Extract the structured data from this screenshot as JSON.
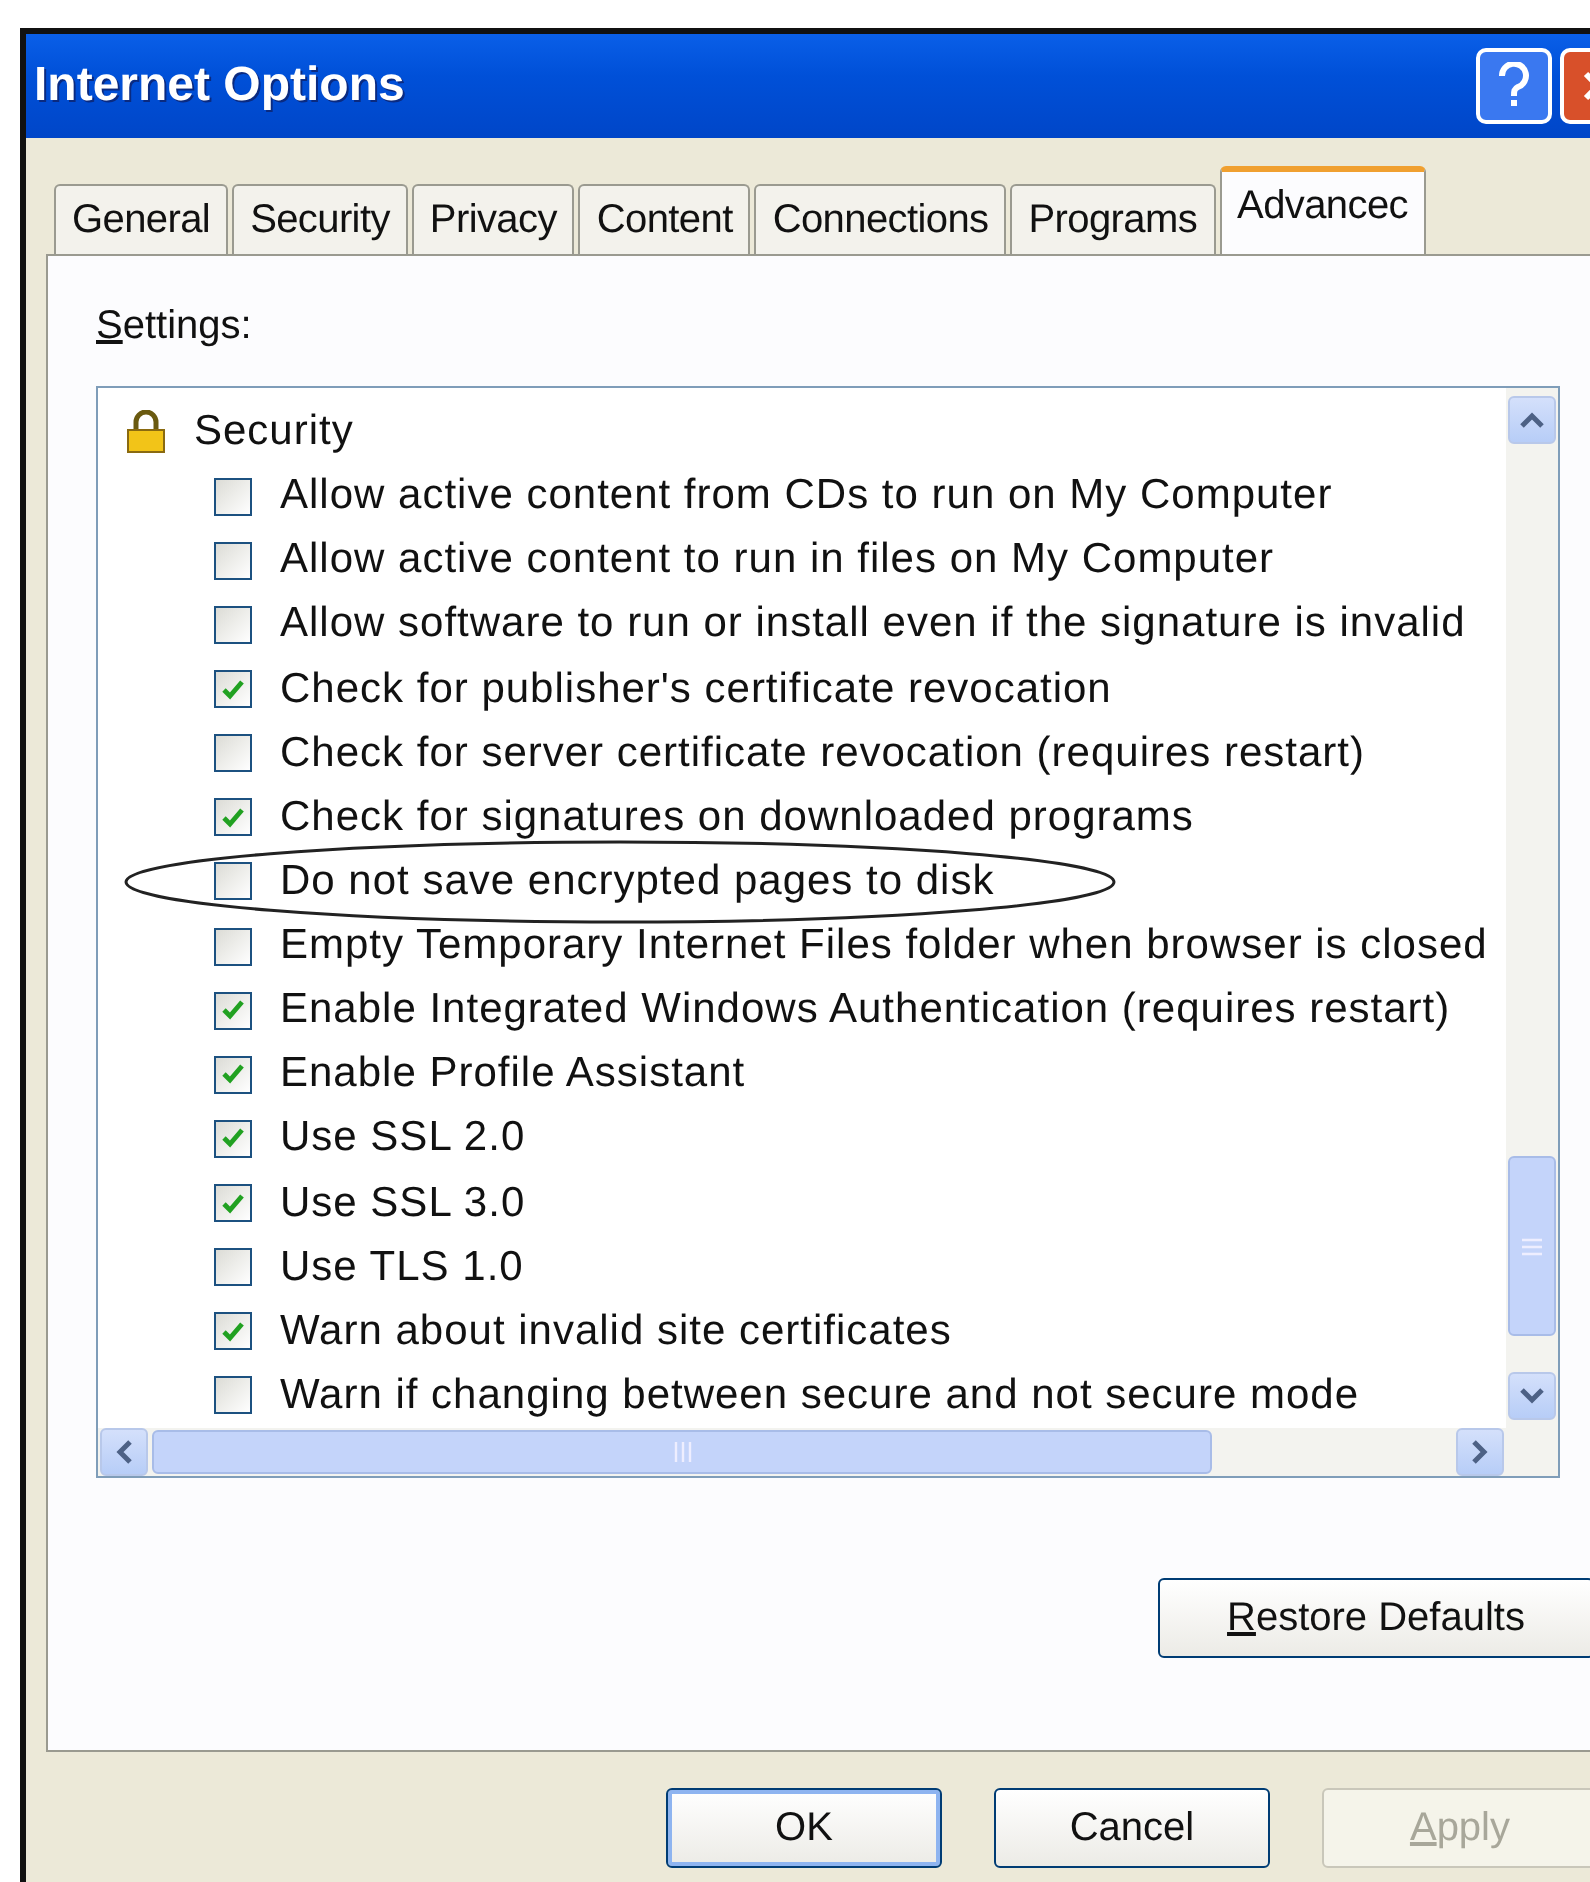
{
  "window": {
    "title": "Internet Options"
  },
  "tabs": [
    {
      "label": "General",
      "selected": false
    },
    {
      "label": "Security",
      "selected": false
    },
    {
      "label": "Privacy",
      "selected": false
    },
    {
      "label": "Content",
      "selected": false
    },
    {
      "label": "Connections",
      "selected": false
    },
    {
      "label": "Programs",
      "selected": false
    },
    {
      "label": "Advancec",
      "selected": true
    }
  ],
  "settings_label": {
    "text": "Settings:",
    "mnemonic": true
  },
  "settings": {
    "group": "Security",
    "items": [
      {
        "label": "Allow active content from CDs to run on My Computer",
        "checked": false,
        "circled": false
      },
      {
        "label": "Allow active content to run in files on My Computer",
        "checked": false,
        "circled": false
      },
      {
        "label": "Allow software to run or install even if the signature is invalid",
        "checked": false,
        "circled": false
      },
      {
        "label": "Check for publisher's certificate revocation",
        "checked": true,
        "circled": false
      },
      {
        "label": "Check for server certificate revocation (requires restart)",
        "checked": false,
        "circled": false
      },
      {
        "label": "Check for signatures on downloaded programs",
        "checked": true,
        "circled": false
      },
      {
        "label": "Do not save encrypted pages to disk",
        "checked": false,
        "circled": true
      },
      {
        "label": "Empty Temporary Internet Files folder when browser is closed",
        "checked": false,
        "circled": false
      },
      {
        "label": "Enable Integrated Windows Authentication (requires restart)",
        "checked": true,
        "circled": false
      },
      {
        "label": "Enable Profile Assistant",
        "checked": true,
        "circled": false
      },
      {
        "label": "Use SSL 2.0",
        "checked": true,
        "circled": false
      },
      {
        "label": "Use SSL 3.0",
        "checked": true,
        "circled": false
      },
      {
        "label": "Use TLS 1.0",
        "checked": false,
        "circled": false
      },
      {
        "label": "Warn about invalid site certificates",
        "checked": true,
        "circled": false
      },
      {
        "label": "Warn if changing between secure and not secure mode",
        "checked": false,
        "circled": false
      }
    ]
  },
  "restore_button": {
    "label": "Restore Defaults",
    "mnemonic": true
  },
  "buttons": [
    {
      "label": "OK",
      "disabled": false,
      "default": true,
      "mnemonic": false
    },
    {
      "label": "Cancel",
      "disabled": false,
      "default": false,
      "mnemonic": false
    },
    {
      "label": "Apply",
      "disabled": true,
      "default": false,
      "mnemonic": true
    }
  ]
}
